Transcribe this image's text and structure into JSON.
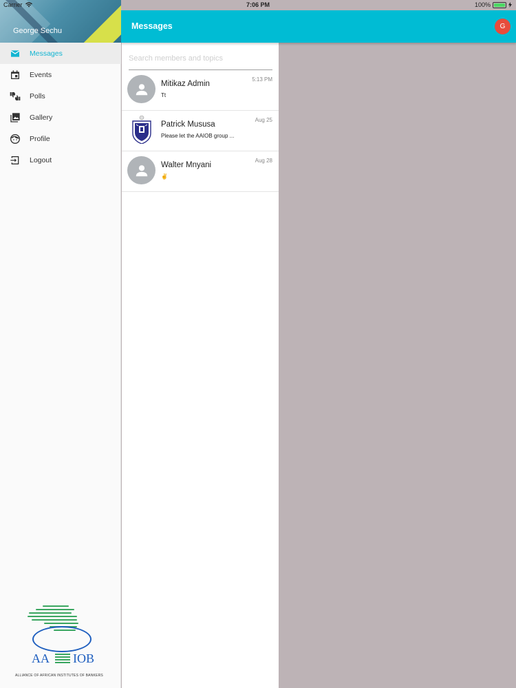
{
  "status_bar": {
    "carrier": "Carrier",
    "time": "7:06 PM",
    "battery": "100%"
  },
  "sidebar": {
    "user_name": "George Sechu",
    "items": [
      {
        "label": "Messages",
        "icon": "mail-icon",
        "active": true
      },
      {
        "label": "Events",
        "icon": "calendar-icon",
        "active": false
      },
      {
        "label": "Polls",
        "icon": "thumbs-icon",
        "active": false
      },
      {
        "label": "Gallery",
        "icon": "photo-library-icon",
        "active": false
      },
      {
        "label": "Profile",
        "icon": "face-icon",
        "active": false
      },
      {
        "label": "Logout",
        "icon": "logout-icon",
        "active": false
      }
    ],
    "logo": {
      "left_text": "AA",
      "right_text": "IOB",
      "tagline": "ALLIANCE OF AFRICAN INSTITUTES OF BANKERS"
    }
  },
  "app_bar": {
    "title": "Messages",
    "avatar_initial": "G",
    "accent_color": "#00bcd4",
    "avatar_color": "#e74c3c"
  },
  "search": {
    "placeholder": "Search members and topics",
    "value": ""
  },
  "messages": [
    {
      "name": "Mitikaz Admin",
      "preview": "Tt",
      "date": "5:13 PM",
      "avatar": "person-icon"
    },
    {
      "name": "Patrick Mususa",
      "preview": "Please let the AAIOB group ...",
      "date": "Aug 25",
      "avatar": "crest-logo"
    },
    {
      "name": "Walter Mnyani",
      "preview": "✌",
      "date": "Aug 28",
      "avatar": "person-icon"
    }
  ]
}
